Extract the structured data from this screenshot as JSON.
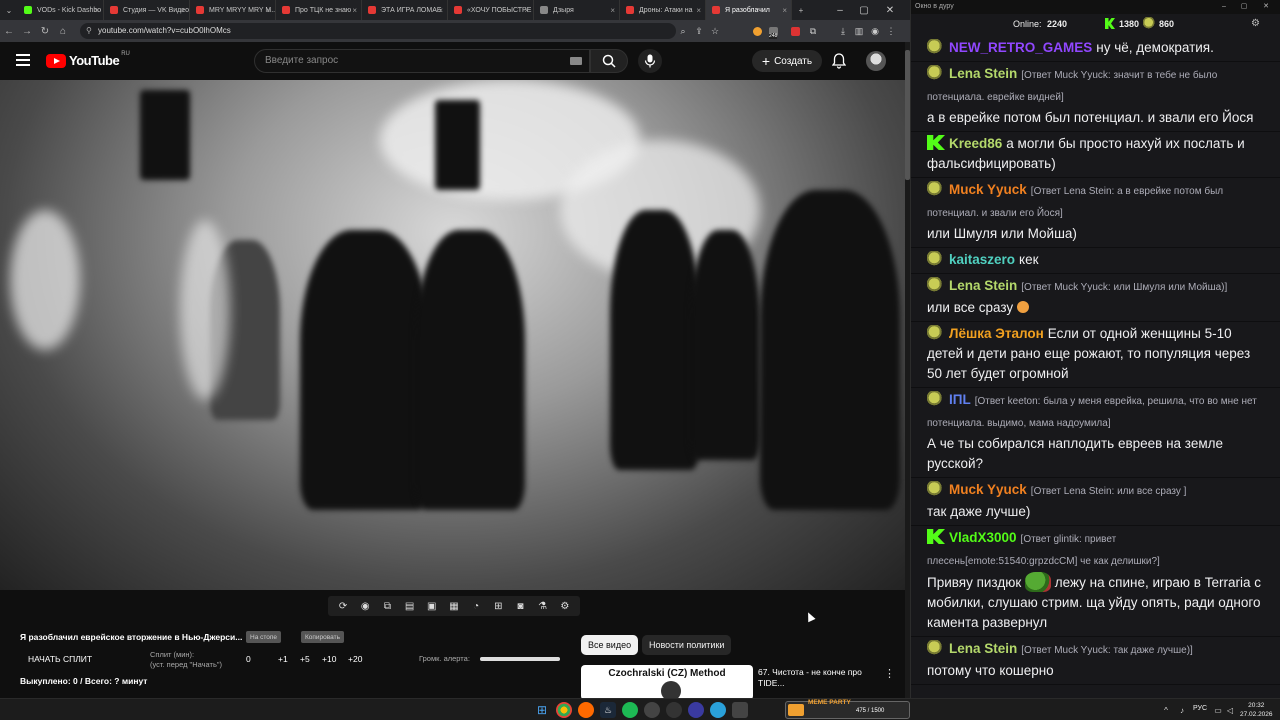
{
  "browser": {
    "tabs": [
      {
        "label": "VODs - Kick Dashbo",
        "fav_color": "#53fc18",
        "active": false
      },
      {
        "label": "Студия — VK Видео",
        "fav_color": "#e53935",
        "active": false
      },
      {
        "label": "MRY MRYY MRY M...",
        "fav_color": "#e53935",
        "active": false
      },
      {
        "label": "Про ТЦК не знаю",
        "fav_color": "#e53935",
        "active": false
      },
      {
        "label": "ЭТА ИГРА ЛОМАЕ",
        "fav_color": "#e53935",
        "active": false
      },
      {
        "label": "«ХОЧУ ПОБЫСТРЕ",
        "fav_color": "#e53935",
        "active": false
      },
      {
        "label": "Дзыря",
        "fav_color": "#888888",
        "active": false
      },
      {
        "label": "Дроны: Атаки на",
        "fav_color": "#e53935",
        "active": false
      },
      {
        "label": "Я разоблачил",
        "fav_color": "#e53935",
        "active": true
      }
    ],
    "url": "youtube.com/watch?v=cubO0lhOMcs",
    "ext_badge": "248"
  },
  "youtube": {
    "country": "RU",
    "logo_text": "YouTube",
    "search_placeholder": "Введите запрос",
    "create_label": "Создать"
  },
  "below_video": {
    "title": "Я разоблачил еврейское вторжение в Нью-Джерси...",
    "btn_na_stop": "На стопе",
    "btn_copy": "Копировать",
    "start_split": "НАЧАТЬ СПЛИТ",
    "split_label": "Сплит (мин):",
    "split_hint": "(уст. перед \"Начать\")",
    "split_value": "0",
    "split_steps": [
      "+1",
      "+5",
      "+10",
      "+20"
    ],
    "alert_label": "Громк. алерта:",
    "alert_volume": 1.0,
    "bought": "Выкуплено: 0 / Всего: ? минут"
  },
  "chips": [
    {
      "label": "Все видео",
      "active": true
    },
    {
      "label": "Новости политики",
      "active": false
    }
  ],
  "recommended": {
    "thumb_title": "Czochralski (CZ) Method",
    "title": "67. Чистота - не конче про TIDE..."
  },
  "chat": {
    "window_title": "Окно в дуру",
    "online_label": "Online:",
    "online_count": "2240",
    "kick_count": "1380",
    "other_count": "860",
    "messages": [
      {
        "badge": "pepe",
        "user": "NEW_RETRO_GAMES",
        "color": "#9147ff",
        "reply": "",
        "text": "ну чё, демократия."
      },
      {
        "badge": "pepe",
        "user": "Lena Stein",
        "color": "#b4d86b",
        "reply": "[Ответ Muck Yyuck: значит в тебе не было потенциала. еврейке видней]",
        "text": "а в еврейке потом был потенциал. и звали его Йося"
      },
      {
        "badge": "kick",
        "user": "Kreed86",
        "color": "#b4d86b",
        "reply": "",
        "text": "а могли бы просто нахуй их послать и фальсифицировать)"
      },
      {
        "badge": "pepe",
        "user": "Muck Yyuck",
        "color": "#f08020",
        "reply": "[Ответ Lena Stein: а в еврейке потом был потенциал. и звали его Йося]",
        "text": "или Шмуля или Мойша)"
      },
      {
        "badge": "pepe",
        "user": "kaitaszero",
        "color": "#50d0c0",
        "reply": "",
        "text": "кек"
      },
      {
        "badge": "pepe",
        "user": "Lena Stein",
        "color": "#b4d86b",
        "reply": "[Ответ Muck Yyuck: или Шмуля или Мойша)]",
        "text": "или все сразу"
      },
      {
        "badge": "pepe",
        "user": "Лёшка Эталон",
        "color": "#f0a020",
        "reply": "",
        "text": "Если от одной женщины 5-10 детей и дети рано еще рожают, то популяция через 50 лет будет огромной"
      },
      {
        "badge": "pepe",
        "user": "IПL",
        "color": "#6080f0",
        "reply": "[Ответ keeton: была у меня еврейка, решила, что во мне нет потенциала. выдимо, мама надоумила]",
        "text": "А че ты собирался наплодить евреев на земле русской?"
      },
      {
        "badge": "pepe",
        "user": "Muck Yyuck",
        "color": "#f08020",
        "reply": "[Ответ Lena Stein: или все сразу ]",
        "text": "так даже лучше)"
      },
      {
        "badge": "kick",
        "user": "VladX3000",
        "color": "#53fc18",
        "reply": "[Ответ glintik: привет плесень[emote:51540:grpzdcCM] че как делишки?]",
        "text": "Привяу пиздюк  лежу на спине, играю в Terraria с мобилки, слушаю стрим. ща уйду опять, ради одного камента развернул"
      },
      {
        "badge": "pepe",
        "user": "Lena Stein",
        "color": "#b4d86b",
        "reply": "[Ответ Muck Yyuck: так даже лучше)]",
        "text": "потому что кошерно"
      }
    ]
  },
  "taskbar": {
    "meme_label": "MEME PARTY",
    "meme_count": "475 / 1500",
    "lang": "РУС",
    "time": "20:32",
    "date": "27.02.2026"
  }
}
